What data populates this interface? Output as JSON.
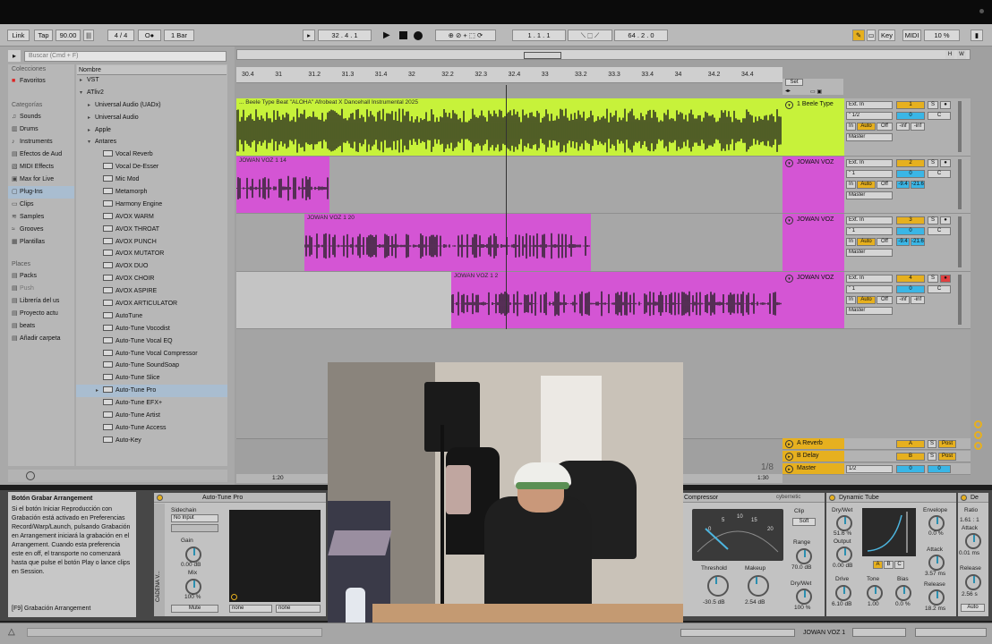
{
  "toolbar": {
    "link": "Link",
    "tap": "Tap",
    "tempo": "90.00",
    "metro": "|||",
    "signature": "4 / 4",
    "metro_state": "O●",
    "quantize": "1 Bar",
    "arr_pos": "32 .   4 .   1",
    "punch_start": "1 .   1 .   1",
    "loop_len": "64 .   2 .   0",
    "key": "Key",
    "midi": "MIDI",
    "cpu": "10 %"
  },
  "browser": {
    "search_placeholder": "Buscar (Cmd + F)",
    "collections_label": "Colecciones",
    "favorites": "Favoritos",
    "categories_label": "Categorías",
    "categories": [
      "Sounds",
      "Drums",
      "Instruments",
      "Efectos de Aud",
      "MIDI Effects",
      "Max for Live",
      "Plug-Ins",
      "Clips",
      "Samples",
      "Grooves",
      "Plantillas"
    ],
    "places_label": "Places",
    "places": [
      "Packs",
      "Push",
      "Librería del us",
      "Proyecto actu",
      "beats",
      "Añadir carpeta"
    ],
    "column_header": "Nombre",
    "tree": [
      {
        "label": "VST",
        "depth": 0,
        "kind": "folder"
      },
      {
        "label": "ATliv2",
        "depth": 0,
        "kind": "folder"
      },
      {
        "label": "Universal Audio (UADx)",
        "depth": 1,
        "kind": "folder"
      },
      {
        "label": "Universal Audio",
        "depth": 1,
        "kind": "folder"
      },
      {
        "label": "Apple",
        "depth": 1,
        "kind": "folder"
      },
      {
        "label": "Antares",
        "depth": 1,
        "kind": "folder"
      },
      {
        "label": "Vocal Reverb",
        "depth": 2,
        "kind": "plugin"
      },
      {
        "label": "Vocal De-Esser",
        "depth": 2,
        "kind": "plugin"
      },
      {
        "label": "Mic Mod",
        "depth": 2,
        "kind": "plugin"
      },
      {
        "label": "Metamorph",
        "depth": 2,
        "kind": "plugin"
      },
      {
        "label": "Harmony Engine",
        "depth": 2,
        "kind": "plugin"
      },
      {
        "label": "AVOX WARM",
        "depth": 2,
        "kind": "plugin"
      },
      {
        "label": "AVOX THROAT",
        "depth": 2,
        "kind": "plugin"
      },
      {
        "label": "AVOX PUNCH",
        "depth": 2,
        "kind": "plugin"
      },
      {
        "label": "AVOX MUTATOR",
        "depth": 2,
        "kind": "plugin"
      },
      {
        "label": "AVOX DUO",
        "depth": 2,
        "kind": "plugin"
      },
      {
        "label": "AVOX CHOIR",
        "depth": 2,
        "kind": "plugin"
      },
      {
        "label": "AVOX ASPIRE",
        "depth": 2,
        "kind": "plugin"
      },
      {
        "label": "AVOX ARTICULATOR",
        "depth": 2,
        "kind": "plugin"
      },
      {
        "label": "AutoTune",
        "depth": 2,
        "kind": "plugin"
      },
      {
        "label": "Auto-Tune Vocodist",
        "depth": 2,
        "kind": "plugin"
      },
      {
        "label": "Auto-Tune Vocal EQ",
        "depth": 2,
        "kind": "plugin"
      },
      {
        "label": "Auto-Tune Vocal Compressor",
        "depth": 2,
        "kind": "plugin"
      },
      {
        "label": "Auto-Tune SoundSoap",
        "depth": 2,
        "kind": "plugin"
      },
      {
        "label": "Auto-Tune Slice",
        "depth": 2,
        "kind": "plugin"
      },
      {
        "label": "Auto-Tune Pro",
        "depth": 2,
        "kind": "plugin",
        "selected": true
      },
      {
        "label": "Auto-Tune EFX+",
        "depth": 2,
        "kind": "plugin"
      },
      {
        "label": "Auto-Tune Artist",
        "depth": 2,
        "kind": "plugin"
      },
      {
        "label": "Auto-Tune Access",
        "depth": 2,
        "kind": "plugin"
      },
      {
        "label": "Auto-Key",
        "depth": 2,
        "kind": "plugin"
      }
    ]
  },
  "ruler": {
    "labels": [
      "30.4",
      "31",
      "31.2",
      "31.3",
      "31.4",
      "32",
      "32.2",
      "32.3",
      "32.4",
      "33",
      "33.2",
      "33.3",
      "33.4",
      "34",
      "34.2",
      "34.4"
    ],
    "bottom_left": "1:20",
    "bottom_right": "1:30",
    "zoom": "1/8",
    "set": "Set"
  },
  "tracks": [
    {
      "name": "1 Beele Type",
      "clip": "... Beele Type Beat \"ALOHA\" Afrobeat X Dancehall Instrumental 2025",
      "color": "#c7f23a",
      "input": "Ext. In",
      "channel": "\" 1/2",
      "number": "1",
      "pan": "C",
      "vol": "-inf",
      "peak": "-inf",
      "out": "Master"
    },
    {
      "name": "JOWAN VOZ",
      "clip": "JOWAN VOZ 1 14",
      "color": "#d455d4",
      "input": "Ext. In",
      "channel": "\" 1",
      "number": "2",
      "pan": "C",
      "vol": "-9.4",
      "peak": "-21.6",
      "out": "Master"
    },
    {
      "name": "JOWAN VOZ",
      "clip": "JOWAN VOZ 1 20",
      "color": "#d455d4",
      "input": "Ext. In",
      "channel": "\" 1",
      "number": "3",
      "pan": "C",
      "vol": "-9.4",
      "peak": "-21.6",
      "out": "Master"
    },
    {
      "name": "JOWAN VOZ",
      "clip": "JOWAN VOZ 1 2",
      "color": "#d455d4",
      "input": "Ext. In",
      "channel": "\" 1",
      "number": "4",
      "pan": "C",
      "vol": "-inf",
      "peak": "-inf",
      "out": "Master"
    }
  ],
  "track_buttons": {
    "in": "In",
    "auto": "Auto",
    "off": "Off",
    "solo": "S",
    "zero": "0"
  },
  "returns": [
    {
      "name": "A Reverb",
      "letter": "A",
      "post": "Post"
    },
    {
      "name": "B Delay",
      "letter": "B",
      "post": "Post"
    },
    {
      "name": "Master",
      "letter": "",
      "post": "",
      "channel": "1/2"
    }
  ],
  "info": {
    "title": "Botón Grabar Arrangement",
    "body": "Si el botón Iniciar Reproducción con Grabación está activado en Preferencias Record/Warp/Launch, pulsando Grabación en Arrangement iniciará la grabación en el Arrangement. Cuando esta preferencia este en off, el transporte no comenzará hasta que pulse el botón Play o lance clips en Session.",
    "footer": "[F9] Grabación Arrangement"
  },
  "autotune": {
    "title": "Auto-Tune Pro",
    "chain": "CADENA V...",
    "sidechain": "Sidechain",
    "input": "No Input",
    "gain_label": "Gain",
    "gain": "0.00 dB",
    "mix_label": "Mix",
    "mix": "100 %",
    "mute": "Mute",
    "none1": "none",
    "none2": "none"
  },
  "compressor": {
    "title": "Compressor",
    "brand": "cybernetic",
    "clip": "Clip",
    "soft": "Soft",
    "threshold_label": "Threshold",
    "threshold": "-30.5 dB",
    "makeup_label": "Makeup",
    "makeup": "2.54 dB",
    "range_label": "Range",
    "range": "70.0 dB",
    "drywet_label": "Dry/Wet",
    "drywet": "100 %",
    "scale": [
      "0",
      "5",
      "10",
      "15",
      "20"
    ]
  },
  "dyntube": {
    "title": "Dynamic Tube",
    "drywet_label": "Dry/Wet",
    "drywet": "51.6 %",
    "output_label": "Output",
    "output": "0.00 dB",
    "drive_label": "Drive",
    "drive": "6.10 dB",
    "tone_label": "Tone",
    "tone": "1.00",
    "bias_label": "Bias",
    "bias": "0.0 %",
    "envelope_label": "Envelope",
    "envelope": "0.0 %",
    "attack_label": "Attack",
    "attack": "3.57 ms",
    "release_label": "Release",
    "release": "18.2 ms",
    "abc": [
      "A",
      "B",
      "C"
    ]
  },
  "dev4": {
    "title": "De",
    "ratio_label": "Ratio",
    "ratio": "1.61 : 1",
    "attack_label": "Attack",
    "attack": "0.01 ms",
    "release_label": "Release",
    "release": "2.56 s",
    "auto": "Auto"
  },
  "status": {
    "track": "JOWAN VOZ 1"
  }
}
